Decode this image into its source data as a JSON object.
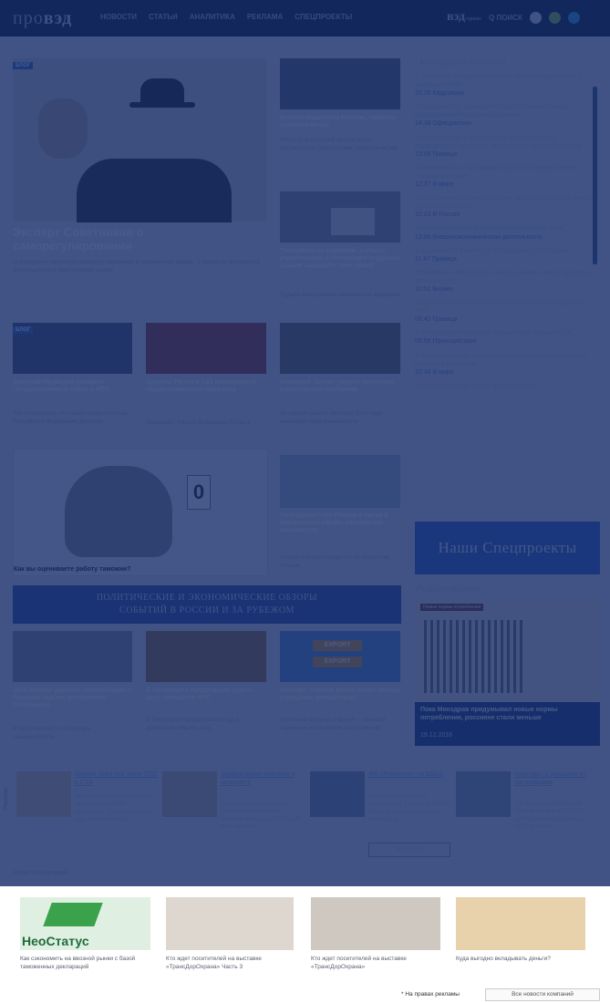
{
  "header": {
    "logo_pro": "про",
    "logo_ved": "вэд",
    "nav": [
      "НОВОСТИ",
      "СТАТЬИ",
      "АНАЛИТИКА",
      "РЕКЛАМА",
      "СПЕЦПРОЕКТЫ"
    ],
    "ved_service": "вэд",
    "service_label": "сервис",
    "search": "Q ПОИСК"
  },
  "main": {
    "lead": {
      "tag": "БЛОГ",
      "title": "Эксперт Советников о саморегулировании",
      "desc": "О внедрении института саморегулирования в таможенной сфере, о развитии брокерской деятельности и перспективах рынка"
    },
    "col2": [
      {
        "title": "Япония подкупила Россию, тормозя развитие Китая",
        "desc": "Когда-то в японской прессе часто обсуждалась перспектива сотрудничества"
      },
      {
        "title": "Поступили на кадровой, а станут строителями: в Петербурге студенты вышли защищать свое право",
        "desc": "Судьба выпускников таможенной академии"
      }
    ],
    "row2": [
      {
        "tag": "БЛОГ",
        "title": "Дмитрий Медведев раскрыл государственную тайну о ФТС",
        "desc": "Так получилось, что глава правительства Российской Федерации Дмитрий"
      },
      {
        "title": "Курилы: Путин и Абэ разморозили территориальную проблему",
        "desc": "Президент России Владимир Путин и"
      },
      {
        "title": "Немецкий бизнес увидел потенциал в российской экономике",
        "desc": "За первое девять месяцев 2016 года немецкие предприниматели"
      }
    ],
    "poll": {
      "question": "Как вы оцениваете работу таможни?",
      "sign": "0"
    },
    "china": {
      "title": "Сотрудничество России и Китая в финансовой сфере: санкции как катализатор",
      "desc": "Россия и Китай находятся по соседству. Общая"
    },
    "banner": {
      "line1": "ПОЛИТИЧЕСКИЕ И ЭКОНОМИЧЕСКИЕ ОБЗОРЫ",
      "line2": "СОБЫТИЙ В РОССИИ И ЗА РУБЕЖОМ"
    },
    "row3": [
      {
        "title": "ОАЭ желают удвоить товарооборот с Россией: оценка экспортного потенциала",
        "desc": "В ОАЭ считают, что позиции товарооборота"
      },
      {
        "title": "В Петербурге продолжают судить двух генералов ФТС",
        "desc": "В Петербурге продолжается суд и доказательства по делу"
      },
      {
        "title": "Экспорт: слабый рубль помог малым и средним экспортерам",
        "desc": "Основная выручка и время — важный параметр экспортеров для развития"
      }
    ],
    "export_signs": [
      "EXPORT",
      "EXPORT"
    ]
  },
  "sidebar": {
    "title": "Последние новости",
    "items": [
      {
        "t": "В Дагестане сотрудники Счетной палаты подозревают в мошенничестве",
        "s": "15:26 Кадровики"
      },
      {
        "t": "Лесная нанесут штрафовать за нелегальный вывоз предпринимательской информации",
        "s": "14:38 Официально"
      },
      {
        "t": "Новые пределы в пограничных пунктах помогут комфортность движения на российско-финской границе",
        "s": "13:08 Граница"
      },
      {
        "t": "Тарифы ввоза пластиковых отпустил Полярные очень Вологда в стране",
        "s": "12:37 В мире"
      },
      {
        "t": "Недостаточное финансирование экспорта по обзору детей из Иркутской области",
        "s": "12:23 В России"
      },
      {
        "t": "Россию предложил в контрольном воздухе в мире",
        "s": "12:06 Внешнеэкономическая деятельность"
      },
      {
        "t": "Фуры не могут въехать на Белоруссию в Астрахани",
        "s": "11:47 Граница"
      },
      {
        "t": "Зарубежные иностранцы в малом бизнесе инвестировать в экономику РФ",
        "s": "10:51 Бизнес"
      },
      {
        "t": "Власти Забайкалья проект усилить контроль на границе с КНР",
        "s": "09:42 Граница"
      },
      {
        "t": "В Монголиском огромное тельные шлагбаумы Ип-18",
        "s": "09:58 Происшествия"
      },
      {
        "t": "В Верховной Раде предложили перемещения украинской полиции в Нью-Йорк",
        "s": "22:46 В мире"
      },
      {
        "t": "В Москву введены новые правила ввоза",
        "s": ""
      }
    ],
    "spec": "Наши Спецпроекты",
    "info_title": "Инфографика",
    "info_caption": "Пока Минздрав придумывал новые нормы потребления, россияне стали меньше",
    "info_date": "19.12.2016",
    "info_chart_title": "Новые нормы потребления"
  },
  "ads": [
    {
      "link": "Берите займ под залог ПТС в CTS",
      "text": "Деньги в офисе за 15 минут без справок. 100% одобрение. Авто остается у вас. balancecredit.ru"
    },
    {
      "link": "Эффективная реклама в интернете",
      "text": "Эффективная интернет-реклама с оценкой по знаниям всего за 14 000 руб! висі. evlina.ru"
    },
    {
      "link": "ЖК «Романтик» на ВДНХ",
      "text": "Квартиры с отделкой, почтовый от 1,9 млн р. 214РЭ Первый взнос 0 р. Звони! romantik.ru"
    },
    {
      "link": "Квартиры в Шушарах от застройщика",
      "text": "ЖК Квартал Московский. Свои квартиры за 14 000 рублей в месяц! Шушары 2018 upspb.ru"
    }
  ],
  "ad_button": "Прокачать",
  "companies_label": "Новости компаний",
  "advert_vertical": "Реклама",
  "lower": {
    "captions": [
      "Как сэкономить на ввозной рынки с базой таможенных деклараций",
      "Кто ждет посетителей на выставке «ТрансДорОхрана» Часть 3",
      "Кто ждет посетителей на выставке «ТрансДорОхрана»",
      "Куда выгодно вкладывать деньги?"
    ],
    "brand": "НеоСтатус",
    "note": "* На правах рекламы",
    "all_button": "Все новости компаний"
  }
}
